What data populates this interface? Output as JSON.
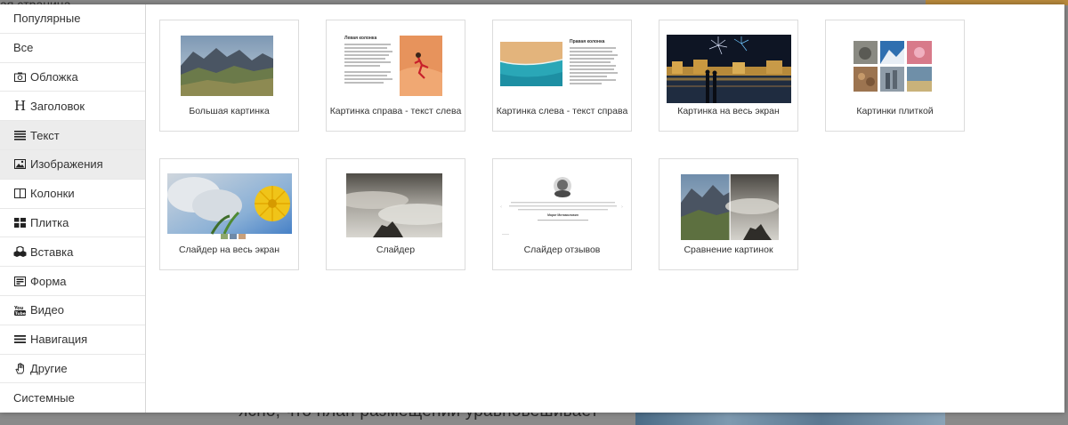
{
  "background": {
    "top_text": "ая страница",
    "bottom_text": "ясно, что план размещений уравновешивает"
  },
  "sidebar": {
    "items": [
      {
        "label": "Популярные",
        "icon": ""
      },
      {
        "label": "Все",
        "icon": ""
      },
      {
        "label": "Обложка",
        "icon": "camera-icon"
      },
      {
        "label": "Заголовок",
        "icon": "heading-icon"
      },
      {
        "label": "Текст",
        "icon": "text-lines-icon"
      },
      {
        "label": "Изображения",
        "icon": "image-icon"
      },
      {
        "label": "Колонки",
        "icon": "columns-icon"
      },
      {
        "label": "Плитка",
        "icon": "tiles-icon"
      },
      {
        "label": "Вставка",
        "icon": "cubes-icon"
      },
      {
        "label": "Форма",
        "icon": "form-icon"
      },
      {
        "label": "Видео",
        "icon": "youtube-icon"
      },
      {
        "label": "Навигация",
        "icon": "menu-icon"
      },
      {
        "label": "Другие",
        "icon": "hand-icon"
      },
      {
        "label": "Системные",
        "icon": ""
      }
    ],
    "active_items": [
      "Текст",
      "Изображения"
    ]
  },
  "cards": [
    {
      "label": "Большая картинка"
    },
    {
      "label": "Картинка справа - текст слева",
      "thumb_title": "Левая колонка"
    },
    {
      "label": "Картинка слева - текст справа",
      "thumb_title": "Правая колонка"
    },
    {
      "label": "Картинка на весь экран"
    },
    {
      "label": "Картинки плиткой"
    },
    {
      "label": "Слайдер на весь экран"
    },
    {
      "label": "Слайдер"
    },
    {
      "label": "Слайдер отзывов",
      "thumb_name": "Марат Митамиловин"
    },
    {
      "label": "Сравнение картинок"
    }
  ],
  "colors": {
    "active_bg": "#ececec",
    "border": "#dcdcdc",
    "text": "#333333"
  }
}
